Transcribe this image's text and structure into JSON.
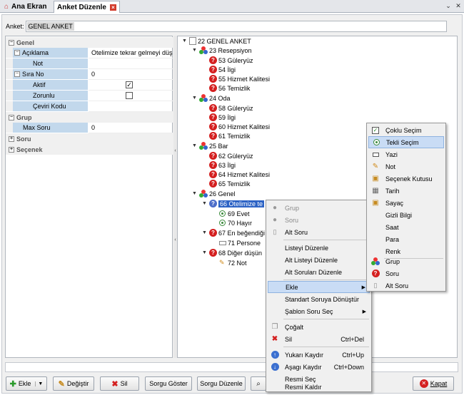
{
  "tabs": [
    {
      "label": "Ana Ekran"
    },
    {
      "label": "Anket Düzenle"
    }
  ],
  "anket": {
    "label": "Anket:",
    "value": "GENEL ANKET"
  },
  "properties": {
    "genel_label": "Genel",
    "aciklama_label": "Açıklama",
    "aciklama_value": "Otelimize tekrar gelmeyi düş",
    "not_label": "Not",
    "sira_label": "Sıra No",
    "sira_value": "0",
    "aktif_label": "Aktif",
    "aktif_checked": "✓",
    "zorunlu_label": "Zorunlu",
    "ceviri_label": "Çeviri Kodu",
    "grup_label": "Grup",
    "max_soru_label": "Max Soru",
    "max_soru_value": "0",
    "soru_label": "Soru",
    "secenek_label": "Seçenek"
  },
  "tree": {
    "root": "22 GENEL ANKET",
    "resepsiyon": "23 Resepsiyon",
    "q53": "53 Güleryüz",
    "q54": "54 İlgi",
    "q55": "55 Hizmet Kalitesi",
    "q56": "56 Temizlik",
    "oda": "24 Oda",
    "q58": "58 Güleryüz",
    "q59": "59 İlgi",
    "q60": "60 Hizmet Kalitesi",
    "q61": "61 Temizlik",
    "bar": "25 Bar",
    "q62": "62 Güleryüz",
    "q63": "63 İlgi",
    "q64": "64 Hizmet Kalitesi",
    "q65": "65 Temizlik",
    "genel": "26 Genel",
    "q66": "66 Otelimize te",
    "o69": "69 Evet",
    "o70": "70 Hayır",
    "q67": "67 En beğendiği",
    "o71": "71 Persone",
    "q68": "68 Diğer düşün",
    "o72": "72 Not"
  },
  "context_menu": {
    "grup": "Grup",
    "soru": "Soru",
    "alt_soru": "Alt Soru",
    "listeyi_duzenle": "Listeyi Düzenle",
    "alt_listeyi_duzenle": "Alt Listeyi Düzenle",
    "alt_sorulari_duzenle": "Alt Soruları Düzenle",
    "ekle": "Ekle",
    "standart": "Standart Soruya Dönüştür",
    "sablon": "Şablon Soru Seç",
    "cogalt": "Çoğalt",
    "sil": "Sil",
    "sil_sc": "Ctrl+Del",
    "yukari": "Yukarı Kaydır",
    "yukari_sc": "Ctrl+Up",
    "asagi": "Aşagı Kaydır",
    "asagi_sc": "Ctrl+Down",
    "resmi_sec": "Resmi Seç",
    "resmi_kaldir": "Resmi Kaldır"
  },
  "submenu": {
    "coklu": "Çoklu Seçim",
    "tekli": "Tekli Seçim",
    "yazi": "Yazi",
    "not": "Not",
    "secenek_kutusu": "Seçenek Kutusu",
    "tarih": "Tarih",
    "sayac": "Sayaç",
    "gizli": "Gizli Bilgi",
    "saat": "Saat",
    "para": "Para",
    "renk": "Renk",
    "grup": "Grup",
    "soru": "Soru",
    "alt_soru": "Alt Soru"
  },
  "buttons": {
    "ekle": "Ekle",
    "degistir": "Değiştir",
    "sil": "Sil",
    "sorgu_goster": "Sorgu Göster",
    "sorgu_duzenle": "Sorgu Düzenle",
    "kapat": "Kapat"
  },
  "colors": {
    "selection": "#2d63c5",
    "property_name_bg": "#c2d8ec",
    "menu_highlight": "#c9dcf5",
    "question_icon": "#d42020"
  }
}
